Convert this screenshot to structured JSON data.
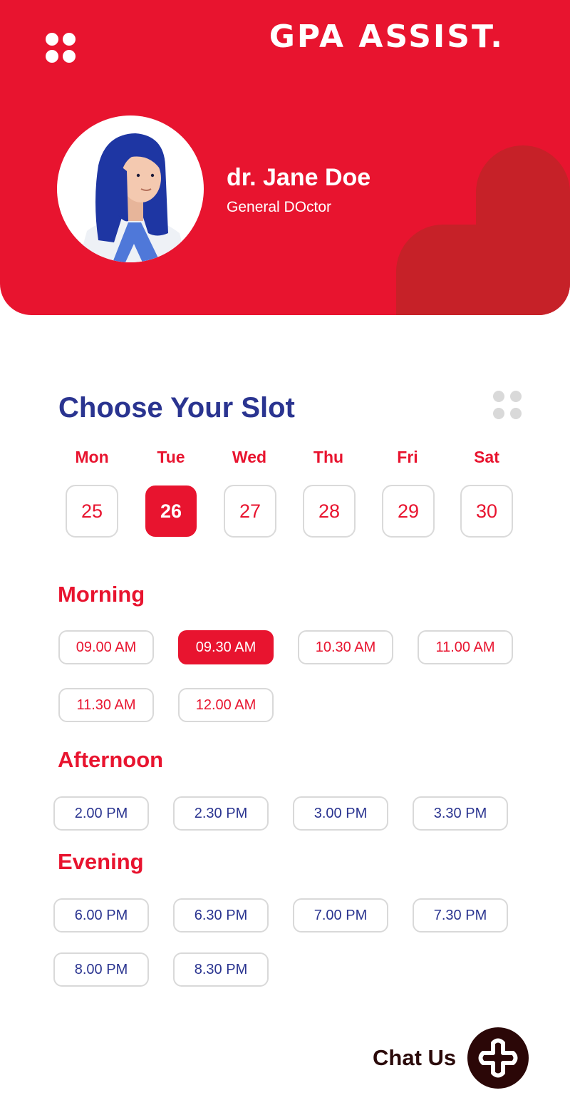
{
  "header": {
    "app_title": "GPA ASSIST.",
    "doctor": {
      "name": "dr. Jane Doe",
      "role": "General DOctor"
    }
  },
  "booking": {
    "title": "Choose Your Slot",
    "days": [
      {
        "label": "Mon",
        "date": "25",
        "selected": false
      },
      {
        "label": "Tue",
        "date": "26",
        "selected": true
      },
      {
        "label": "Wed",
        "date": "27",
        "selected": false
      },
      {
        "label": "Thu",
        "date": "28",
        "selected": false
      },
      {
        "label": "Fri",
        "date": "29",
        "selected": false
      },
      {
        "label": "Sat",
        "date": "30",
        "selected": false
      }
    ],
    "morning": {
      "label": "Morning",
      "slots": [
        "09.00 AM",
        "09.30 AM",
        "10.30 AM",
        "11.00 AM",
        "11.30 AM",
        "12.00 AM"
      ],
      "selected_slot": "09.30 AM"
    },
    "afternoon": {
      "label": "Afternoon",
      "slots": [
        "2.00 PM",
        "2.30 PM",
        "3.00 PM",
        "3.30 PM"
      ]
    },
    "evening": {
      "label": "Evening",
      "slots": [
        "6.00 PM",
        "6.30 PM",
        "7.00 PM",
        "7.30 PM",
        "8.00 PM",
        "8.30 PM"
      ]
    }
  },
  "chat": {
    "label": "Chat Us"
  },
  "colors": {
    "brand_red": "#E8142F",
    "heart_red": "#C62128",
    "title_blue": "#2A3490",
    "chat_dark": "#2B0707",
    "border_gray": "#D9D9D9"
  },
  "icons": {
    "menu": "four-dots-menu-icon",
    "grid": "four-dots-grid-icon",
    "chat": "plus-cross-icon",
    "decor": "heart-icon"
  }
}
